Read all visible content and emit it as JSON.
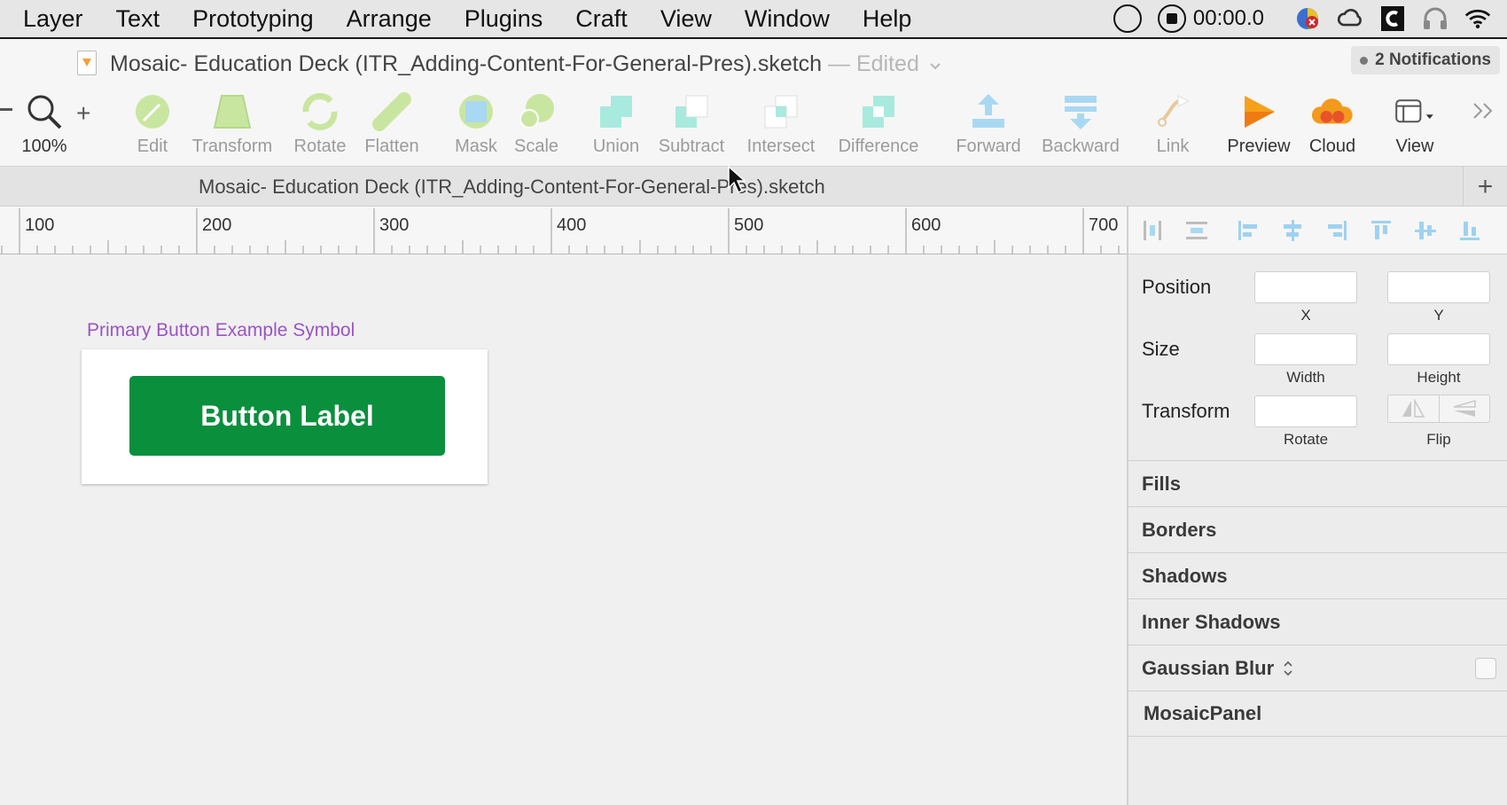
{
  "menubar": {
    "items": [
      "Layer",
      "Text",
      "Prototyping",
      "Arrange",
      "Plugins",
      "Craft",
      "View",
      "Window",
      "Help"
    ],
    "timer": "00:00.0"
  },
  "title": {
    "document": "Mosaic- Education Deck (ITR_Adding-Content-For-General-Pres).sketch",
    "edited": "— Edited",
    "notifications": "2 Notifications"
  },
  "toolbar": {
    "zoom": "100%",
    "tools": {
      "edit": "Edit",
      "transform": "Transform",
      "rotate": "Rotate",
      "flatten": "Flatten",
      "mask": "Mask",
      "scale": "Scale",
      "union": "Union",
      "subtract": "Subtract",
      "intersect": "Intersect",
      "difference": "Difference",
      "forward": "Forward",
      "backward": "Backward",
      "link": "Link",
      "preview": "Preview",
      "cloud": "Cloud",
      "view": "View"
    }
  },
  "tab": {
    "title": "Mosaic- Education Deck (ITR_Adding-Content-For-General-Pres).sketch",
    "add": "+"
  },
  "ruler": {
    "labels": [
      "100",
      "200",
      "300",
      "400",
      "500",
      "600",
      "700"
    ]
  },
  "canvas": {
    "artboard_label": "Primary Button Example Symbol",
    "button_label": "Button Label",
    "button_color": "#0a8f3d",
    "artboard_label_color": "#9a54c4"
  },
  "inspector": {
    "position_label": "Position",
    "x_label": "X",
    "y_label": "Y",
    "size_label": "Size",
    "width_label": "Width",
    "height_label": "Height",
    "transform_label": "Transform",
    "rotate_label": "Rotate",
    "flip_label": "Flip",
    "sections": {
      "fills": "Fills",
      "borders": "Borders",
      "shadows": "Shadows",
      "inner_shadows": "Inner Shadows",
      "gaussian_blur": "Gaussian Blur",
      "mosaic_panel": "MosaicPanel"
    }
  }
}
